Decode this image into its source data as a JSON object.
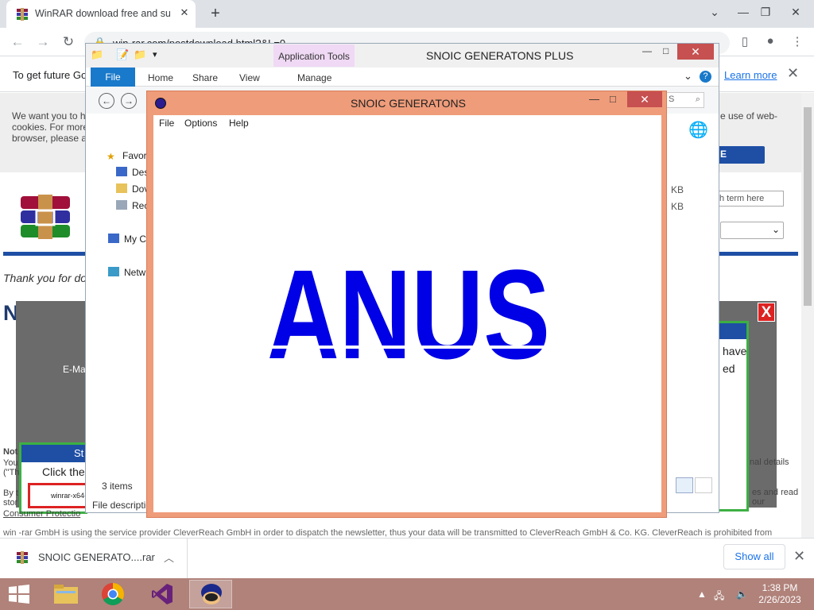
{
  "browser": {
    "tab_title": "WinRAR download free and supp",
    "url": "win-rar.com/postdownload.html?&L=0",
    "infobar_text": "To get future Go",
    "infobar_link": "Learn more"
  },
  "page": {
    "cookie_left": "We want you to h cookies. For more browser, please a",
    "cookie_right": "e use of web-",
    "accept_label": "E",
    "search_placeholder": "h term here",
    "thanks_text": "Thank you for do",
    "now_get": "Now ge",
    "email_label": "E-Ma",
    "right_box_text": "have ed",
    "left_box_header": "St",
    "left_box_click": "Click the",
    "left_box_file": "winrar-x64-",
    "note_label": "Not",
    "you_label": "You (\"Th",
    "by_label": "By t stor",
    "consumer_label": "Consumer Protectio",
    "personal_details": "nal details",
    "read_our": "es and read our",
    "footer_text": "win -rar GmbH is using the service provider CleverReach GmbH in order to dispatch the newsletter, thus your data will be transmitted to CleverReach GmbH & Co. KG. CleverReach is prohibited from"
  },
  "downloads": {
    "item_name": "SNOIC GENERATO....rar",
    "show_all": "Show all"
  },
  "explorer": {
    "title": "SNOIC GENERATONS PLUS",
    "app_tools": "Application Tools",
    "tabs": [
      "File",
      "Home",
      "Share",
      "View",
      "Manage"
    ],
    "search": "S",
    "nav": [
      "Favor",
      "Des",
      "Dov",
      "Rec",
      "My C",
      "Netw"
    ],
    "sizes": [
      "KB",
      "KB"
    ],
    "status": "3 items",
    "desc": "File descriptic"
  },
  "snoic": {
    "title": "SNOIC GENERATONS",
    "menu": [
      "File",
      "Options",
      "Help"
    ],
    "big_text": "ANUS",
    "big_color": "#0000e6"
  },
  "taskbar": {
    "time": "1:38 PM",
    "date": "2/26/2023"
  }
}
